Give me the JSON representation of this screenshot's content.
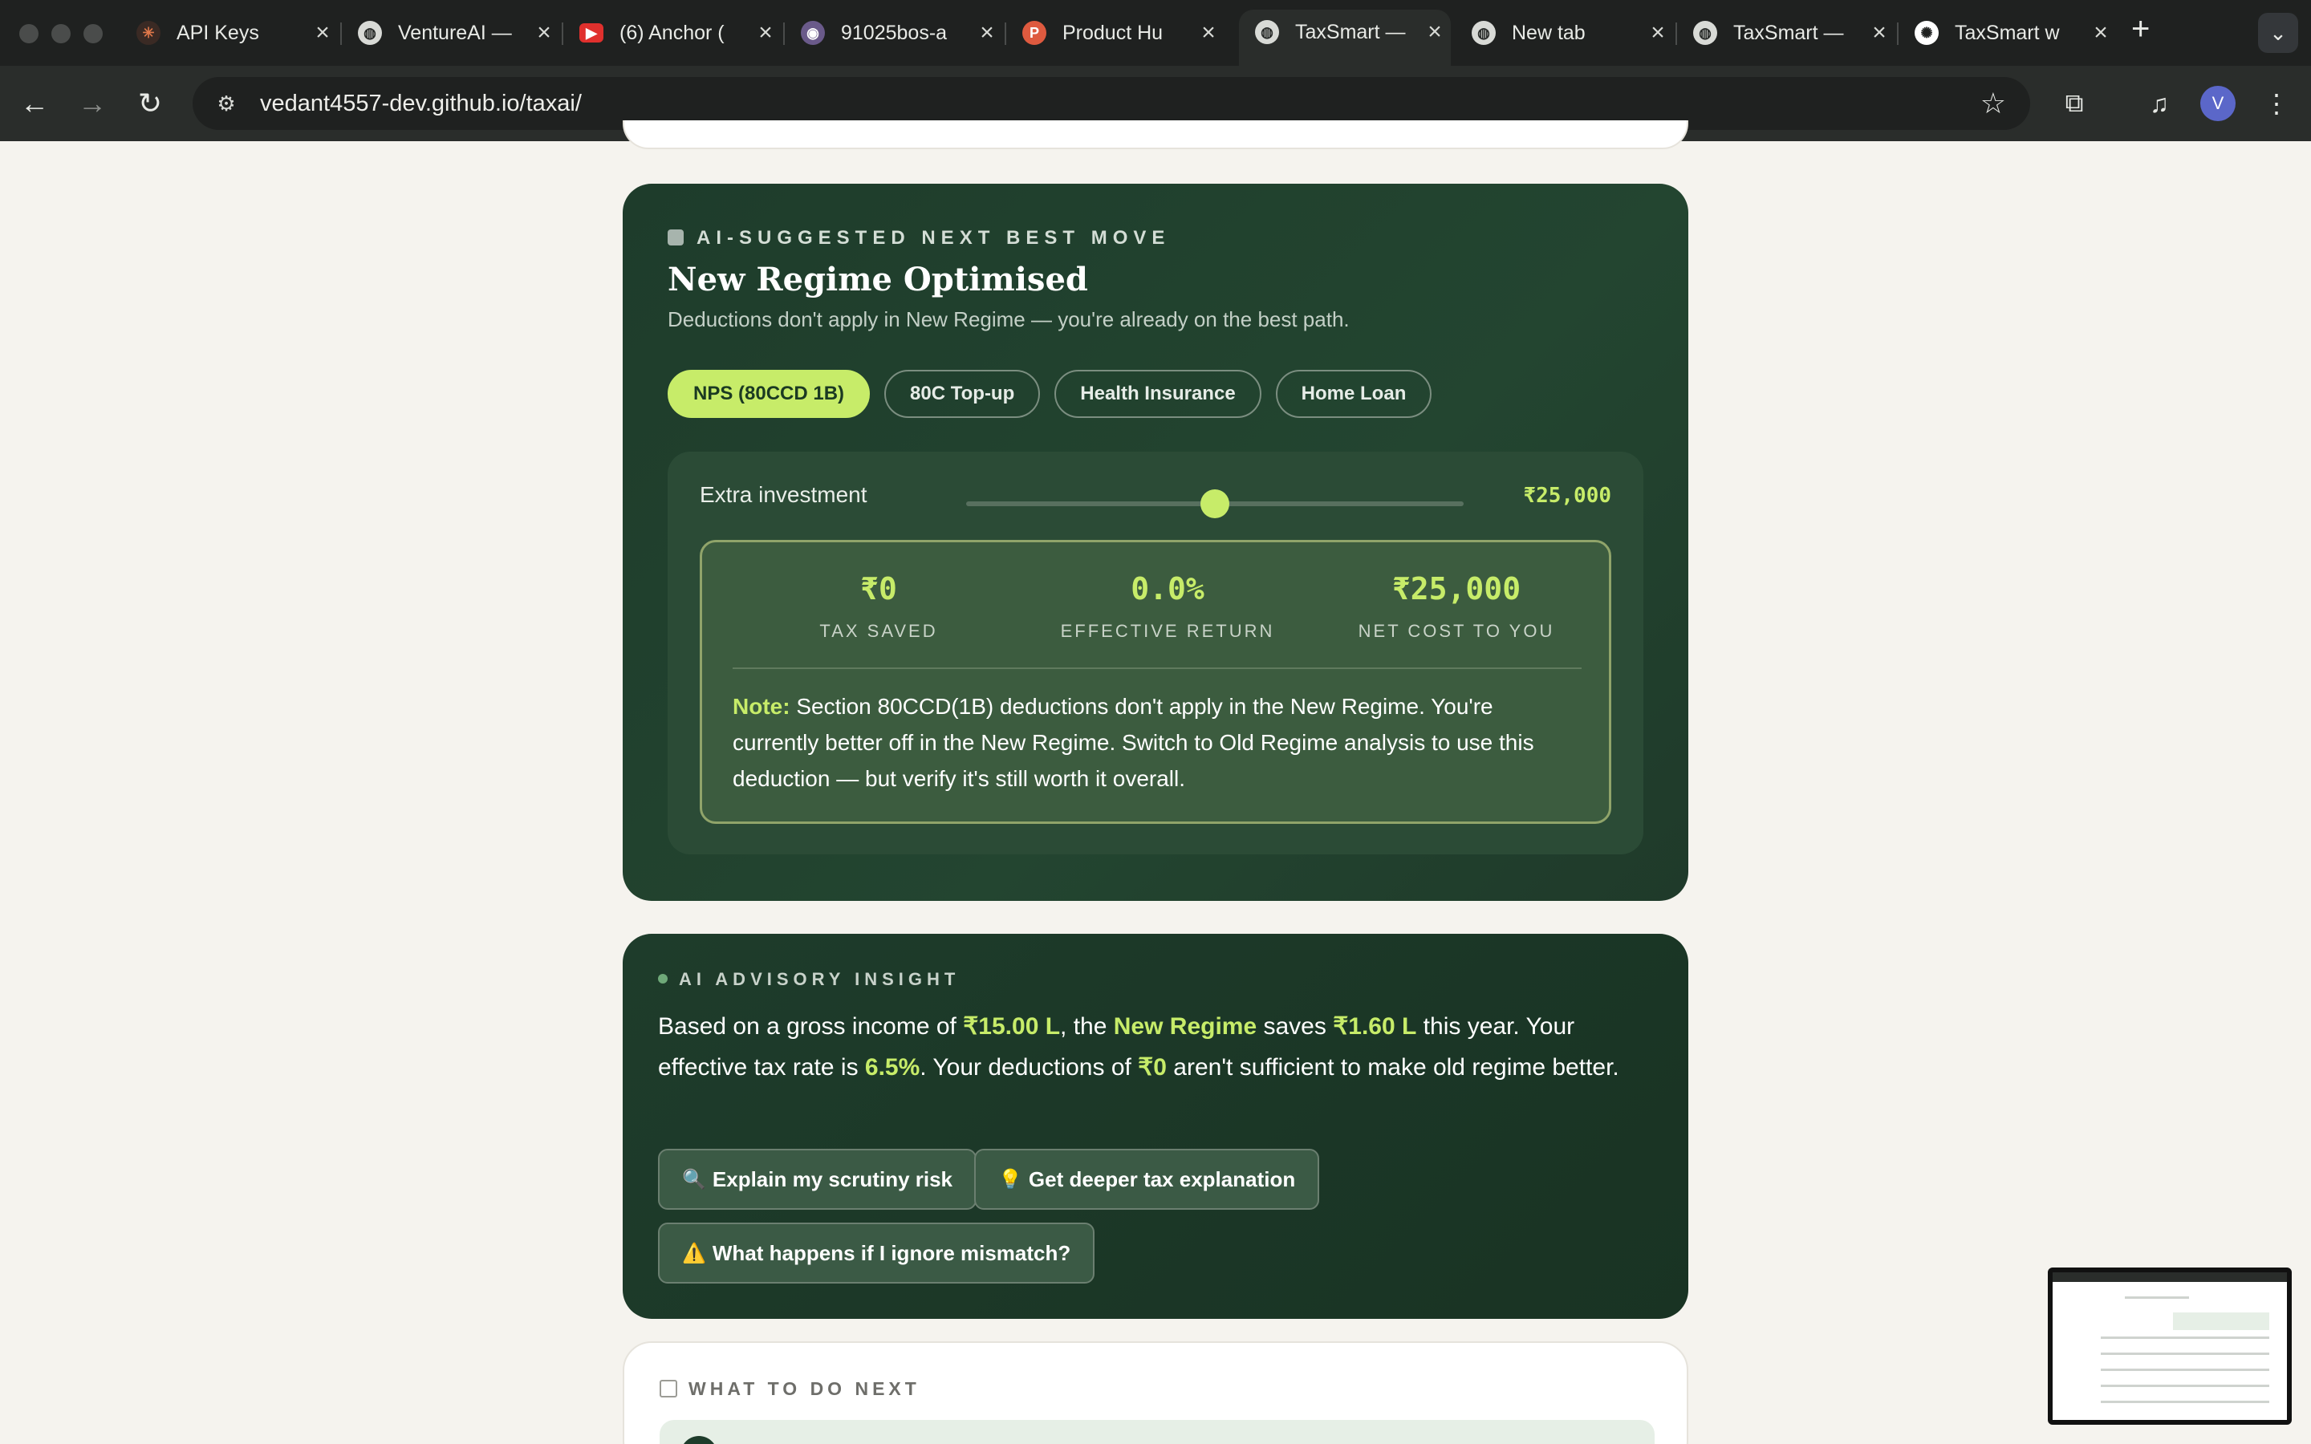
{
  "browser": {
    "tabs": [
      {
        "label": "API Keys",
        "icon": "asterisk-icon"
      },
      {
        "label": "VentureAI —",
        "icon": "globe-icon"
      },
      {
        "label": "(6) Anchor (",
        "icon": "youtube-icon"
      },
      {
        "label": "91025bos-a",
        "icon": "badge-icon"
      },
      {
        "label": "Product Hu",
        "icon": "producthunt-icon"
      },
      {
        "label": "TaxSmart —",
        "icon": "globe-icon"
      },
      {
        "label": "New tab",
        "icon": "globe-icon"
      },
      {
        "label": "TaxSmart —",
        "icon": "globe-icon"
      },
      {
        "label": "TaxSmart w",
        "icon": "openai-icon"
      }
    ],
    "active_tab_index": 5,
    "url": "vedant4557-dev.github.io/taxai/",
    "profile_initial": "V"
  },
  "next_move": {
    "eyebrow": "AI-SUGGESTED NEXT BEST MOVE",
    "title": "New Regime Optimised",
    "subtitle": "Deductions don't apply in New Regime — you're already on the best path.",
    "pills": [
      "NPS (80CCD 1B)",
      "80C Top-up",
      "Health Insurance",
      "Home Loan"
    ],
    "active_pill_index": 0,
    "slider": {
      "label": "Extra investment",
      "value_text": "₹25,000",
      "fraction": 0.5
    },
    "stats": [
      {
        "value": "₹0",
        "label": "TAX SAVED"
      },
      {
        "value": "0.0%",
        "label": "EFFECTIVE RETURN"
      },
      {
        "value": "₹25,000",
        "label": "NET COST TO YOU"
      }
    ],
    "note_label": "Note:",
    "note_text": " Section 80CCD(1B) deductions don't apply in the New Regime. You're currently better off in the New Regime. Switch to Old Regime analysis to use this deduction — but verify it's still worth it overall."
  },
  "insight": {
    "eyebrow": "AI ADVISORY INSIGHT",
    "t1": "Based on a gross income of ",
    "income": "₹15.00 L",
    "t2": ", the ",
    "regime": "New Regime",
    "t3": " saves ",
    "saves": "₹1.60 L",
    "t4": " this year. Your effective tax rate is ",
    "rate": "6.5%",
    "t5": ". Your deductions of ",
    "deductions": "₹0",
    "t6": " aren't sufficient to make old regime better.",
    "buttons": [
      {
        "icon": "🔍",
        "label": "Explain my scrutiny risk"
      },
      {
        "icon": "💡",
        "label": "Get deeper tax explanation"
      },
      {
        "icon": "⚠️",
        "label": "What happens if I ignore mismatch?"
      }
    ]
  },
  "next_steps": {
    "eyebrow": "WHAT TO DO NEXT"
  },
  "colors": {
    "accent": "#c7ec69",
    "card_dark": "#1e3c2b"
  }
}
